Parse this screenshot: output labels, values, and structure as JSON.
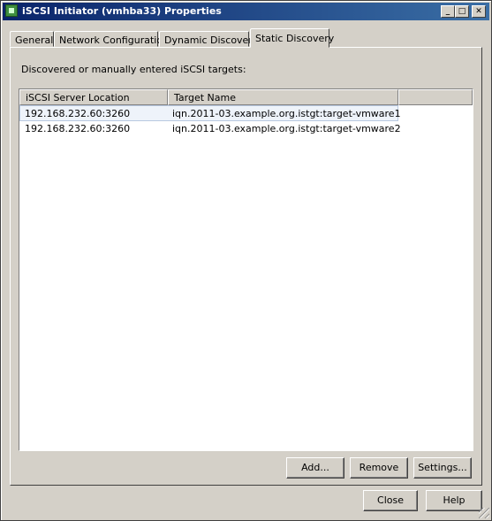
{
  "window": {
    "title": "iSCSI Initiator (vmhba33) Properties"
  },
  "title_buttons": {
    "minimize": "_",
    "maximize": "□",
    "close": "✕"
  },
  "tabs": [
    {
      "label": "General"
    },
    {
      "label": "Network Configuration"
    },
    {
      "label": "Dynamic Discovery"
    },
    {
      "label": "Static Discovery",
      "active": true
    }
  ],
  "panel": {
    "description": "Discovered or manually entered iSCSI targets:",
    "columns": [
      "iSCSI Server Location",
      "Target Name"
    ],
    "rows": [
      {
        "location": "192.168.232.60:3260",
        "target": "iqn.2011-03.example.org.istgt:target-vmware1",
        "selected": true
      },
      {
        "location": "192.168.232.60:3260",
        "target": "iqn.2011-03.example.org.istgt:target-vmware2"
      }
    ],
    "buttons": {
      "add": "Add...",
      "remove": "Remove",
      "settings": "Settings..."
    }
  },
  "footer": {
    "close": "Close",
    "help": "Help"
  },
  "icons": {
    "app": "iscsi-adapter-icon",
    "grip": "resize-grip-icon"
  }
}
